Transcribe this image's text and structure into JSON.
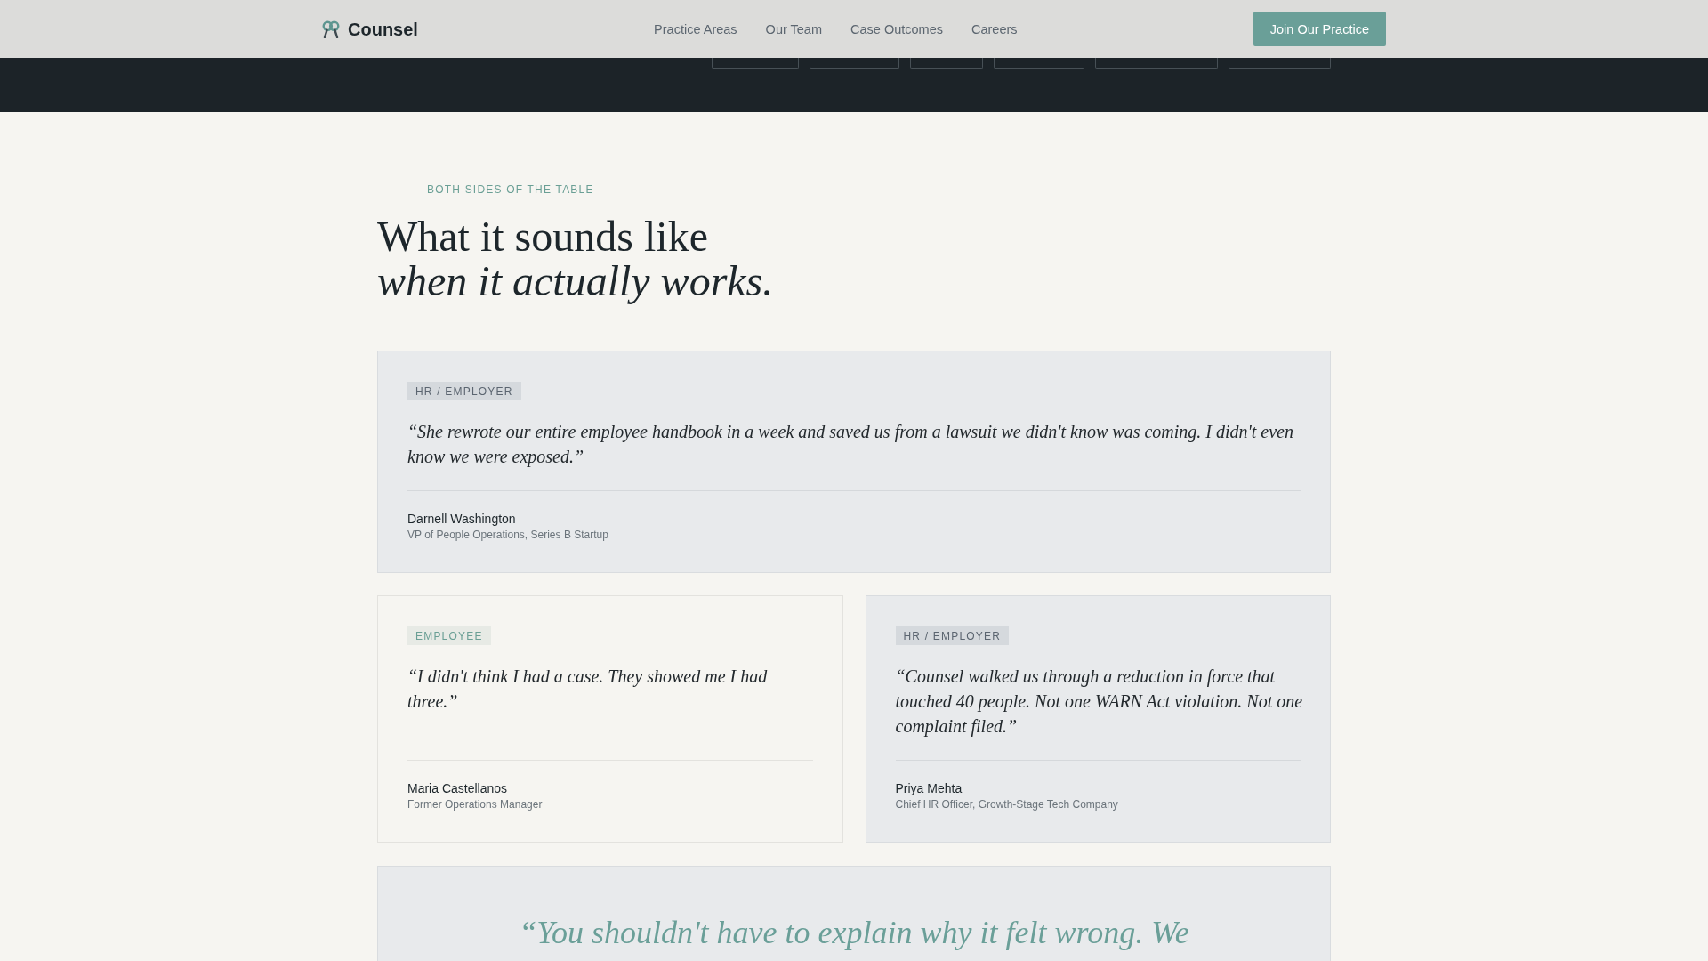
{
  "navbar": {
    "brand": "Counsel",
    "links": [
      {
        "label": "Practice Areas"
      },
      {
        "label": "Our Team"
      },
      {
        "label": "Case Outcomes"
      },
      {
        "label": "Careers"
      }
    ],
    "cta": "Join Our Practice"
  },
  "section": {
    "eyebrow": "BOTH SIDES OF THE TABLE",
    "title": "What it sounds like",
    "title_italic": "when it actually works."
  },
  "testimonials": [
    {
      "kind": "employer",
      "featured": true,
      "tag": "HR / EMPLOYER",
      "quote": "“She rewrote our entire employee handbook in a week and saved us from a lawsuit we didn't know was coming. I didn't even know we were exposed.”",
      "name": "Darnell Washington",
      "role": "VP of People Operations, Series B Startup"
    },
    {
      "kind": "employee",
      "featured": false,
      "tag": "EMPLOYEE",
      "quote": "“I didn't think I had a case. They showed me I had three.”",
      "name": "Maria Castellanos",
      "role": "Former Operations Manager"
    },
    {
      "kind": "employer",
      "featured": false,
      "tag": "HR / EMPLOYER",
      "quote": "“Counsel walked us through a reduction in force that touched 40 people. Not one WARN Act violation. Not one complaint filed.”",
      "name": "Priya Mehta",
      "role": "Chief HR Officer, Growth-Stage Tech Company"
    }
  ],
  "pull_quote": {
    "text": "“You shouldn't have to explain why it felt wrong. We"
  }
}
